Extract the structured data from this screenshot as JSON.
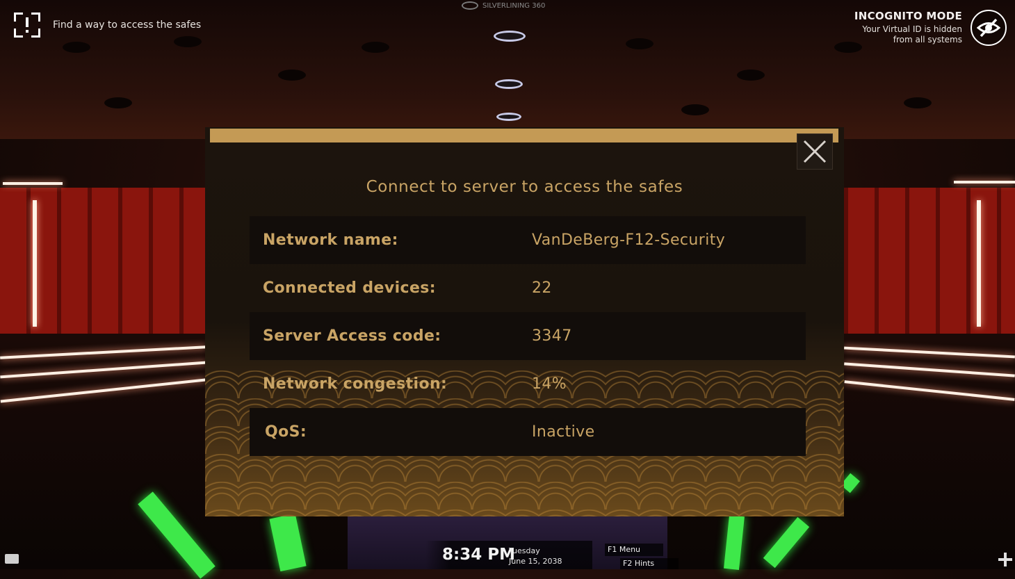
{
  "hud": {
    "objective": "Find a way to access the safes",
    "brand": "SILVERLINING 360",
    "incognito_title": "INCOGNITO MODE",
    "incognito_line1": "Your Virtual ID is hidden",
    "incognito_line2": "from all systems"
  },
  "dialog": {
    "title": "Connect to server to access the safes",
    "rows": [
      {
        "label": "Network name:",
        "value": "VanDeBerg-F12-Security"
      },
      {
        "label": "Connected devices:",
        "value": "22"
      },
      {
        "label": "Server Access code:",
        "value": "3347"
      },
      {
        "label": "Network congestion:",
        "value": "14%"
      },
      {
        "label": "QoS:",
        "value": "Inactive"
      }
    ]
  },
  "bottom": {
    "time": "8:34 PM",
    "day": "Tuesday",
    "date": "June 15, 2038",
    "f1": "F1 Menu",
    "f2": "F2 Hints"
  },
  "colors": {
    "accent_gold": "#c9a465",
    "title_bar": "#c49a55",
    "wall_red": "#8a150d",
    "neon_green": "#3ee84a"
  },
  "icons": {
    "objective": "objective-alert-icon",
    "incognito": "eye-slash-icon",
    "close": "close-icon",
    "chat": "chat-icon",
    "add": "plus-icon",
    "brand": "silverlining-logo-icon"
  }
}
